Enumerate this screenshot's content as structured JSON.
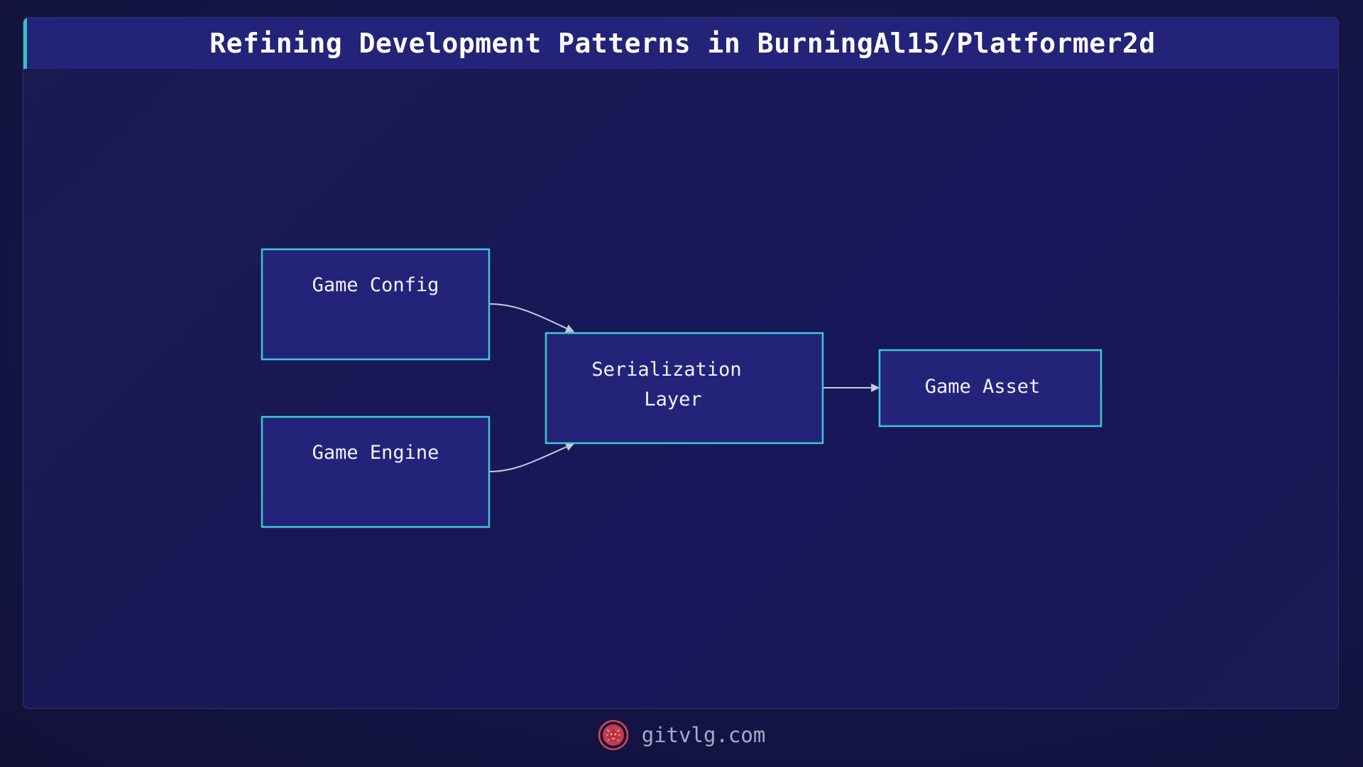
{
  "title": "Refining Development Patterns in BurningAl15/Platformer2d",
  "nodes": {
    "game_config": {
      "label": "Game Config"
    },
    "game_engine": {
      "label": "Game Engine"
    },
    "serialization": {
      "label_line1": "Serialization",
      "label_line2": "Layer"
    },
    "game_asset": {
      "label": "Game Asset"
    }
  },
  "edges": [
    {
      "from": "Game Config",
      "to": "Serialization Layer"
    },
    {
      "from": "Game Engine",
      "to": "Serialization Layer"
    },
    {
      "from": "Serialization Layer",
      "to": "Game Asset"
    }
  ],
  "footer": {
    "site": "gitvlg.com",
    "logo_icon": "lion-logo-icon"
  },
  "colors": {
    "node_fill": "#23237a",
    "node_border": "#3ec8d4",
    "accent": "#2ec4c8",
    "logo": "#e0444e"
  }
}
